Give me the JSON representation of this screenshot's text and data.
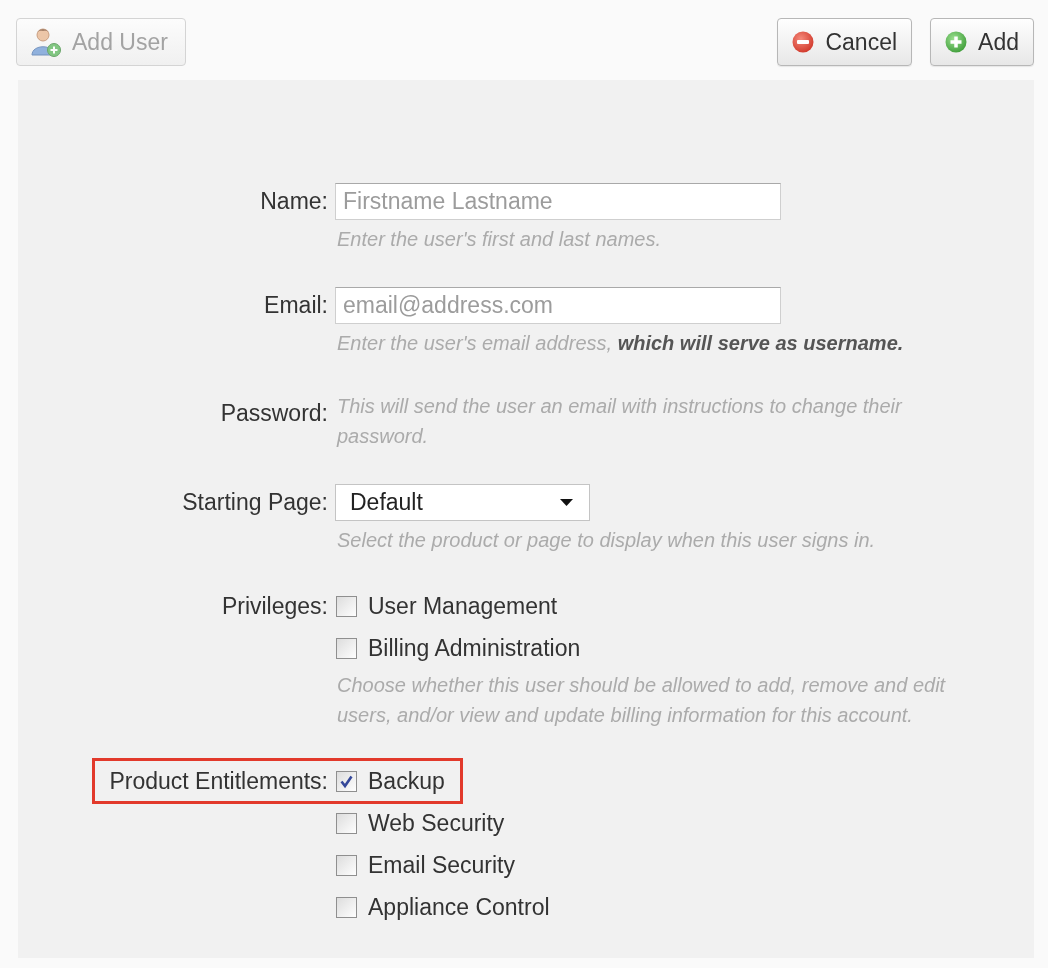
{
  "toolbar": {
    "title_button": {
      "label": "Add User",
      "disabled": true
    },
    "actions": [
      {
        "label": "Cancel",
        "kind": "cancel"
      },
      {
        "label": "Add",
        "kind": "add"
      }
    ]
  },
  "user_form": {
    "rows": [
      {
        "kind": "text",
        "label": "Name:",
        "placeholder": "Firstname Lastname",
        "hint": "Enter the user's first and last names."
      },
      {
        "kind": "text",
        "label": "Email:",
        "placeholder": "email@address.com",
        "hint": "Enter the user's email address, **which will serve as username.**"
      },
      {
        "kind": "note",
        "label": "Password:",
        "note": "This will send the user an email with instructions to change their password."
      },
      {
        "kind": "select",
        "label": "Starting Page:",
        "value": "Default",
        "hint": "Select the product or page to display when this user signs in."
      },
      {
        "kind": "checkboxes",
        "label": "Privileges:",
        "options": [
          {
            "label": "User Management",
            "checked": false
          },
          {
            "label": "Billing Administration",
            "checked": false
          }
        ],
        "hint": "Choose whether this user should be allowed to add, remove and edit users, and/or view and update billing information for this account."
      },
      {
        "kind": "checkboxes",
        "label": "Product Entitlements:",
        "highlighted": true,
        "options": [
          {
            "label": "Backup",
            "checked": true
          },
          {
            "label": "Web Security",
            "checked": false
          },
          {
            "label": "Email Security",
            "checked": false
          },
          {
            "label": "Appliance Control",
            "checked": false
          }
        ]
      }
    ]
  }
}
